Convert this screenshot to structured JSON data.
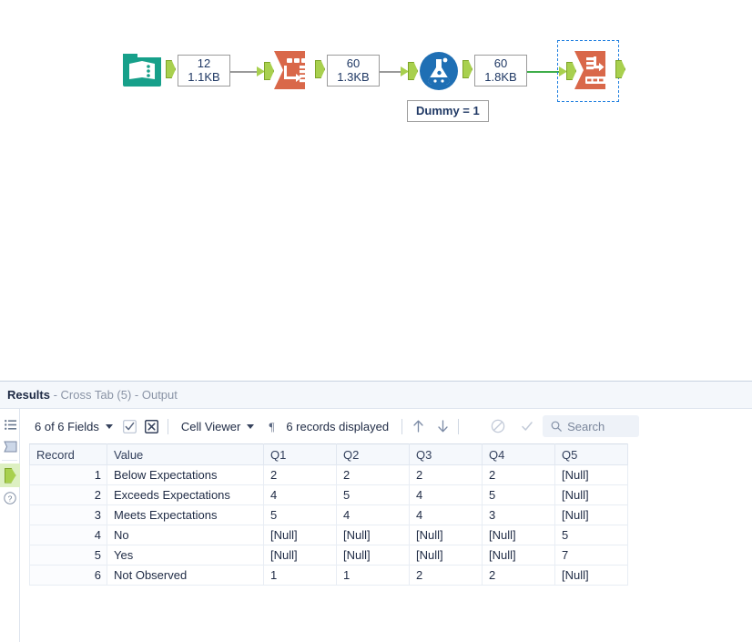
{
  "canvas": {
    "nodes": [
      {
        "id": "input-data",
        "tool": "Input Data",
        "icon": "book-icon",
        "color": "#17a08a"
      },
      {
        "id": "transpose",
        "tool": "Transpose",
        "icon": "transpose-icon",
        "color": "#d9684a"
      },
      {
        "id": "formula",
        "tool": "Formula",
        "icon": "flask-icon",
        "color": "#1f6fb4"
      },
      {
        "id": "cross-tab",
        "tool": "Cross Tab",
        "icon": "crosstab-icon",
        "color": "#d9684a"
      }
    ],
    "data_labels": [
      {
        "records": "12",
        "size": "1.1KB"
      },
      {
        "records": "60",
        "size": "1.3KB"
      },
      {
        "records": "60",
        "size": "1.8KB"
      }
    ],
    "annotation": "Dummy = 1",
    "selected_node": "cross-tab",
    "selection_color": "#1f7fe0"
  },
  "results": {
    "title_bold": "Results",
    "title_rest": " - Cross Tab (5) - Output",
    "rail": [
      {
        "name": "list-view-icon",
        "glyph": "≡"
      },
      {
        "name": "layout-icon",
        "glyph": "⬛"
      },
      {
        "name": "output-anchor",
        "glyph": ""
      },
      {
        "name": "help-icon",
        "glyph": "?"
      }
    ],
    "toolbar": {
      "fields_label": "6 of 6 Fields",
      "select_all_icon": "checkbox-checked-icon",
      "deselect_all_icon": "checkbox-x-icon",
      "viewer_label": "Cell Viewer",
      "pilcrow_icon": "¶",
      "records_label": "6 records displayed",
      "up_arrow": "↑",
      "down_arrow": "↓",
      "no_errors_icon": "⊘",
      "ok_icon": "✓",
      "search_placeholder": "Search"
    },
    "table": {
      "columns": [
        "Record",
        "Value",
        "Q1",
        "Q2",
        "Q3",
        "Q4",
        "Q5"
      ],
      "null_text": "[Null]",
      "rows": [
        {
          "record": "1",
          "value": "Below Expectations",
          "q1": "2",
          "q2": "2",
          "q3": "2",
          "q4": "2",
          "q5": "[Null]"
        },
        {
          "record": "2",
          "value": "Exceeds Expectations",
          "q1": "4",
          "q2": "5",
          "q3": "4",
          "q4": "5",
          "q5": "[Null]"
        },
        {
          "record": "3",
          "value": "Meets Expectations",
          "q1": "5",
          "q2": "4",
          "q3": "4",
          "q4": "3",
          "q5": "[Null]"
        },
        {
          "record": "4",
          "value": "No",
          "q1": "[Null]",
          "q2": "[Null]",
          "q3": "[Null]",
          "q4": "[Null]",
          "q5": "5"
        },
        {
          "record": "5",
          "value": "Yes",
          "q1": "[Null]",
          "q2": "[Null]",
          "q3": "[Null]",
          "q4": "[Null]",
          "q5": "7"
        },
        {
          "record": "6",
          "value": "Not Observed",
          "q1": "1",
          "q2": "1",
          "q3": "2",
          "q4": "2",
          "q5": "[Null]"
        }
      ]
    }
  }
}
